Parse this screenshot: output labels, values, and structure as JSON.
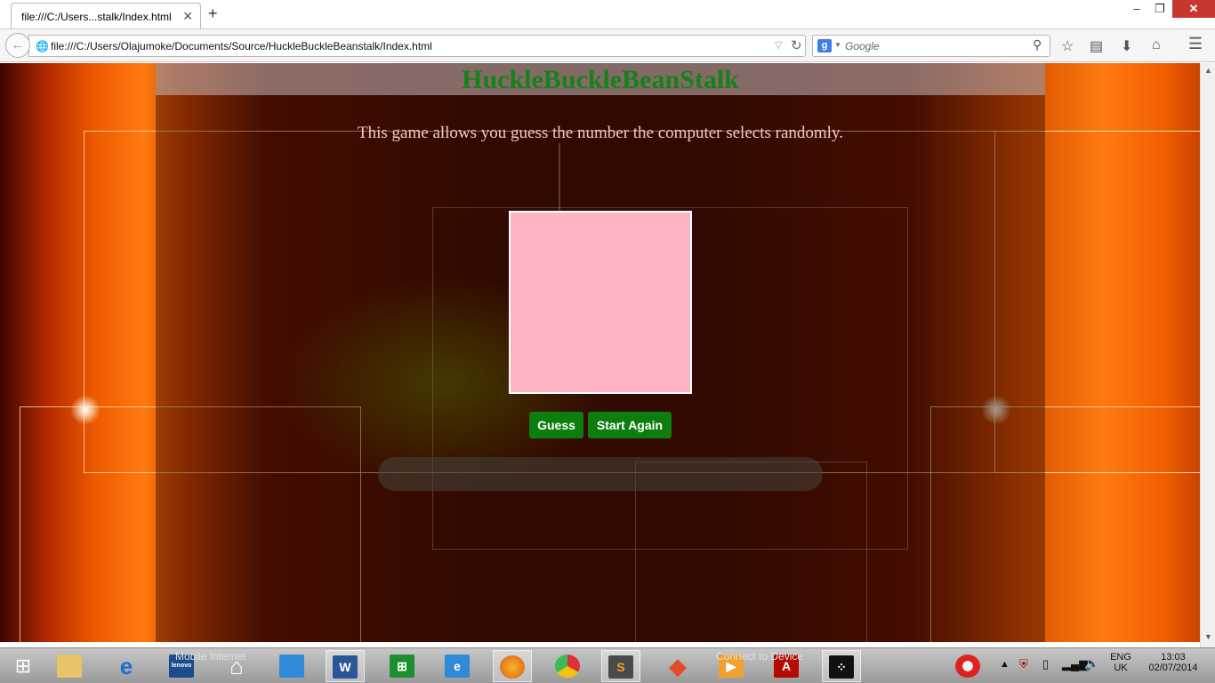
{
  "browser": {
    "tab_title": "file:///C:/Users...stalk/Index.html",
    "tab_close": "✕",
    "new_tab": "+",
    "url": "file:///C:/Users/Olajumoke/Documents/Source/HuckleBuckleBeanstalk/Index.html",
    "search_placeholder": "Google",
    "search_engine_letter": "g",
    "window_buttons": {
      "minimize": "–",
      "maximize": "❐",
      "close": "✕"
    }
  },
  "page": {
    "title": "HuckleBuckleBeanStalk",
    "description": "This game allows you guess the number the computer selects randomly.",
    "buttons": {
      "guess": "Guess",
      "start_again": "Start Again"
    },
    "result_text": "",
    "game_box_color": "#ffb3c2"
  },
  "taskbar": {
    "ghost_labels": {
      "mobile_internet": "Mobile Internet",
      "connect": "Connect to Device"
    },
    "apps": [
      {
        "name": "windows-start",
        "glyph": "⊞"
      },
      {
        "name": "file-explorer",
        "glyph": "📁"
      },
      {
        "name": "internet-explorer",
        "glyph": "e"
      },
      {
        "name": "lenovo-display",
        "glyph": "lenovo"
      },
      {
        "name": "home",
        "glyph": "⌂"
      },
      {
        "name": "store",
        "glyph": "🛍"
      },
      {
        "name": "word",
        "glyph": "W"
      },
      {
        "name": "windows-store",
        "glyph": "⊞"
      },
      {
        "name": "ie-blue",
        "glyph": "e"
      },
      {
        "name": "firefox",
        "glyph": "🦊"
      },
      {
        "name": "chrome",
        "glyph": "◉"
      },
      {
        "name": "sublime-text",
        "glyph": "S"
      },
      {
        "name": "git",
        "glyph": "◆"
      },
      {
        "name": "media-player",
        "glyph": "▶"
      },
      {
        "name": "adobe-reader",
        "glyph": "A"
      },
      {
        "name": "blackberry",
        "glyph": "⁘"
      }
    ],
    "tray": {
      "language_top": "ENG",
      "language_bottom": "UK",
      "time": "13:03",
      "date": "02/07/2014"
    }
  }
}
